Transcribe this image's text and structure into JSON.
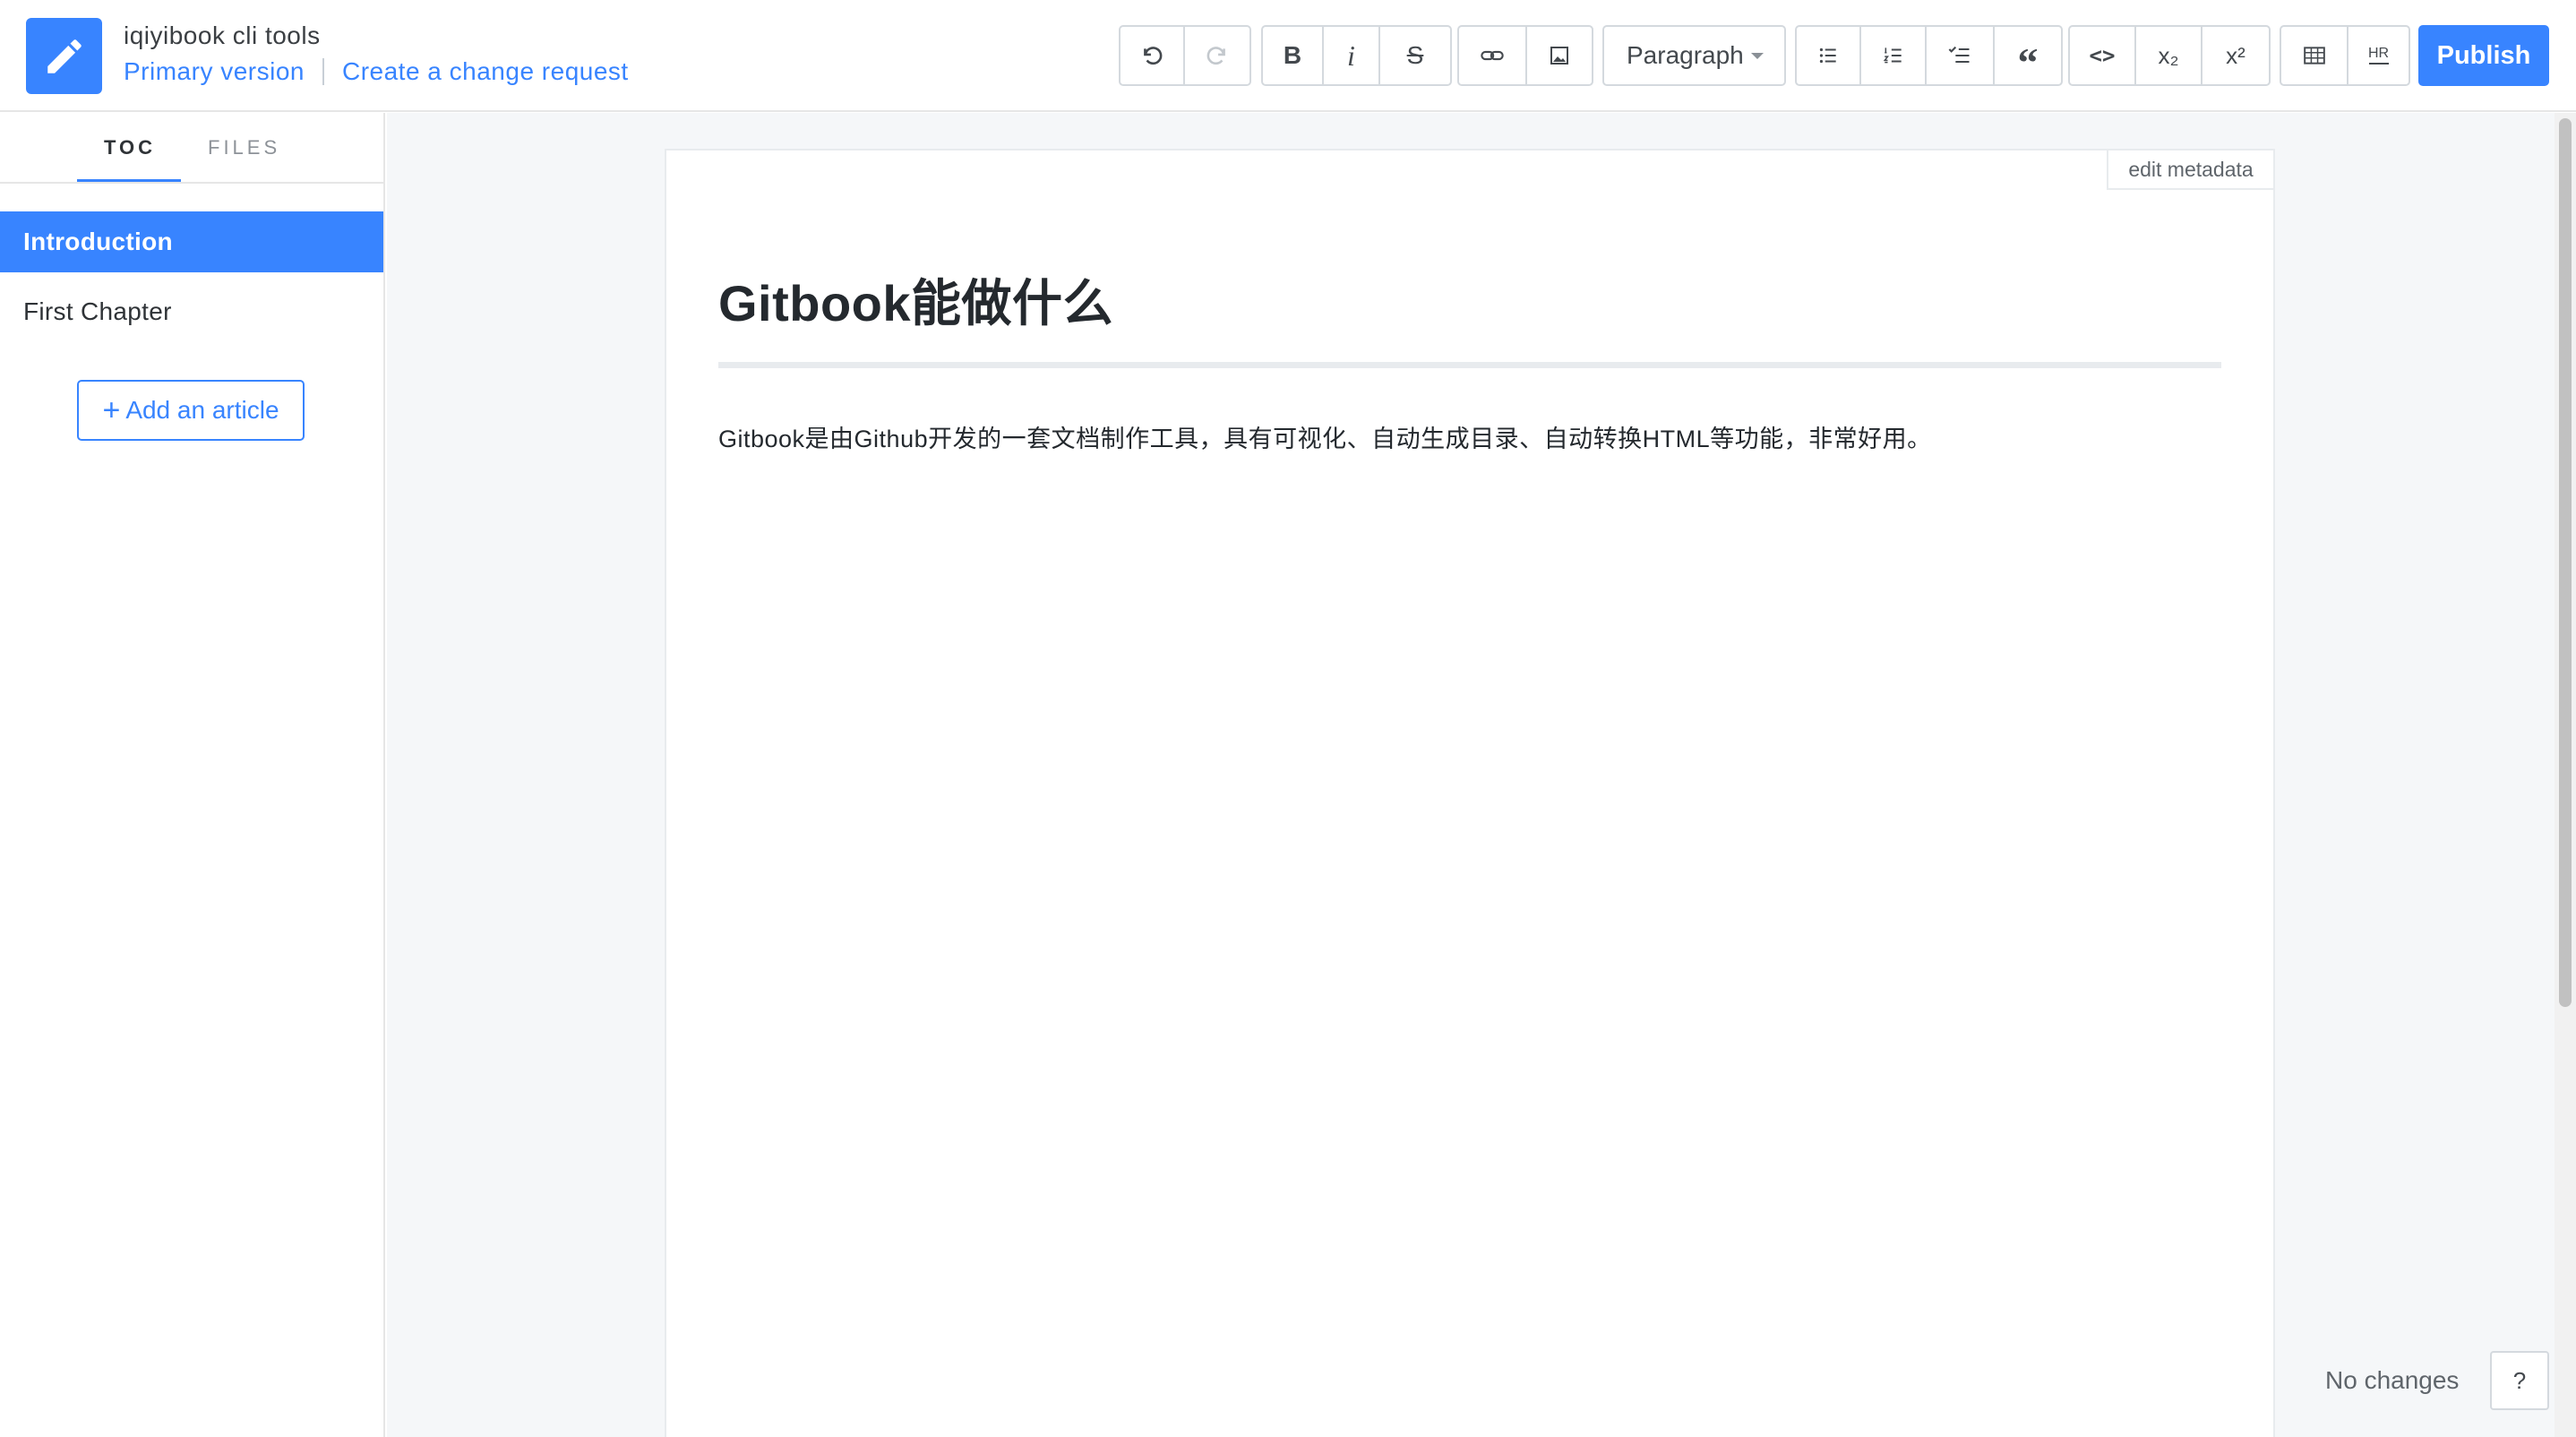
{
  "header": {
    "app_title": "iqiyibook cli tools",
    "version_link": "Primary version",
    "change_request_link": "Create a change request",
    "publish_label": "Publish",
    "accent_color": "#3884ff"
  },
  "toolbar": {
    "undo_icon": "undo-icon",
    "redo_icon": "redo-icon",
    "bold_label": "B",
    "italic_label": "i",
    "strike_label": "S",
    "link_icon": "link-icon",
    "image_icon": "image-icon",
    "block_type": "Paragraph",
    "bullet_list_icon": "bullet-list-icon",
    "numbered_list_icon": "numbered-list-icon",
    "task_list_icon": "task-list-icon",
    "quote_label": "“",
    "code_label": "<>",
    "subscript_label": "x₂",
    "superscript_label": "x²",
    "table_icon": "table-icon",
    "hr_label": "HR"
  },
  "sidebar": {
    "tabs": [
      "TOC",
      "FILES"
    ],
    "active_tab": "TOC",
    "items": [
      {
        "label": "Introduction",
        "active": true
      },
      {
        "label": "First Chapter",
        "active": false
      }
    ],
    "add_article_label": "Add an article"
  },
  "editor": {
    "edit_metadata_label": "edit metadata",
    "title": "Gitbook能做什么",
    "body": "Gitbook是由Github开发的一套文档制作工具，具有可视化、自动生成目录、自动转换HTML等功能，非常好用。"
  },
  "status": {
    "text": "No changes",
    "help_label": "?"
  }
}
